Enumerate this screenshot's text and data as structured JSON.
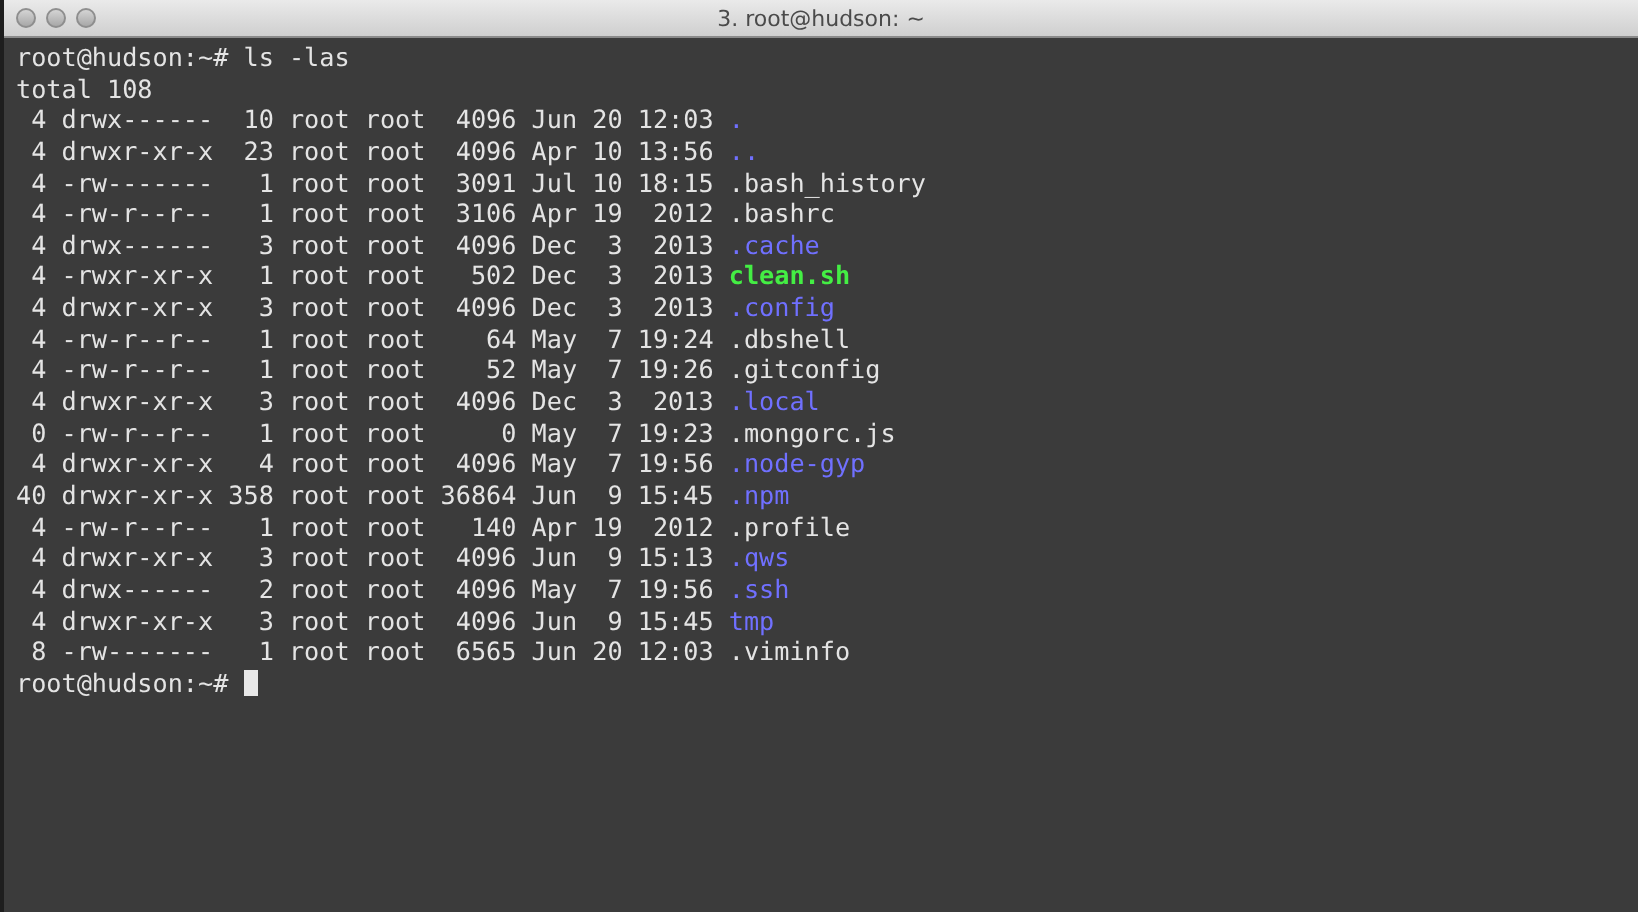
{
  "window": {
    "title": "3. root@hudson: ~"
  },
  "terminal": {
    "command_line": "root@hudson:~# ls -las",
    "total": "total 108",
    "entries": [
      {
        "details": " 4 drwx------  10 root root  4096 Jun 20 12:03",
        "name": ".",
        "kind": "dir"
      },
      {
        "details": " 4 drwxr-xr-x  23 root root  4096 Apr 10 13:56",
        "name": "..",
        "kind": "dir"
      },
      {
        "details": " 4 -rw-------   1 root root  3091 Jul 10 18:15",
        "name": ".bash_history",
        "kind": "file"
      },
      {
        "details": " 4 -rw-r--r--   1 root root  3106 Apr 19  2012",
        "name": ".bashrc",
        "kind": "file"
      },
      {
        "details": " 4 drwx------   3 root root  4096 Dec  3  2013",
        "name": ".cache",
        "kind": "dir"
      },
      {
        "details": " 4 -rwxr-xr-x   1 root root   502 Dec  3  2013",
        "name": "clean.sh",
        "kind": "exec"
      },
      {
        "details": " 4 drwxr-xr-x   3 root root  4096 Dec  3  2013",
        "name": ".config",
        "kind": "dir"
      },
      {
        "details": " 4 -rw-r--r--   1 root root    64 May  7 19:24",
        "name": ".dbshell",
        "kind": "file"
      },
      {
        "details": " 4 -rw-r--r--   1 root root    52 May  7 19:26",
        "name": ".gitconfig",
        "kind": "file"
      },
      {
        "details": " 4 drwxr-xr-x   3 root root  4096 Dec  3  2013",
        "name": ".local",
        "kind": "dir"
      },
      {
        "details": " 0 -rw-r--r--   1 root root     0 May  7 19:23",
        "name": ".mongorc.js",
        "kind": "file"
      },
      {
        "details": " 4 drwxr-xr-x   4 root root  4096 May  7 19:56",
        "name": ".node-gyp",
        "kind": "dir"
      },
      {
        "details": "40 drwxr-xr-x 358 root root 36864 Jun  9 15:45",
        "name": ".npm",
        "kind": "dir"
      },
      {
        "details": " 4 -rw-r--r--   1 root root   140 Apr 19  2012",
        "name": ".profile",
        "kind": "file"
      },
      {
        "details": " 4 drwxr-xr-x   3 root root  4096 Jun  9 15:13",
        "name": ".qws",
        "kind": "dir"
      },
      {
        "details": " 4 drwx------   2 root root  4096 May  7 19:56",
        "name": ".ssh",
        "kind": "dir"
      },
      {
        "details": " 4 drwxr-xr-x   3 root root  4096 Jun  9 15:45",
        "name": "tmp",
        "kind": "dir"
      },
      {
        "details": " 8 -rw-------   1 root root  6565 Jun 20 12:03",
        "name": ".viminfo",
        "kind": "file"
      }
    ],
    "prompt": "root@hudson:~#"
  }
}
